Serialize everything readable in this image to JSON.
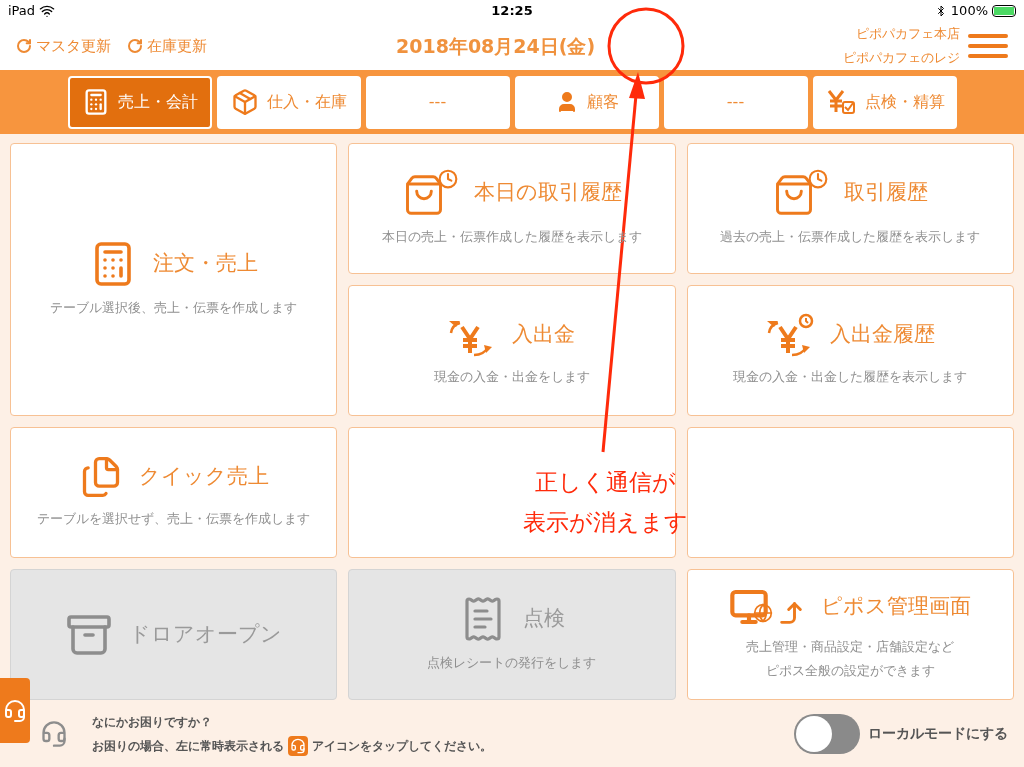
{
  "status_bar": {
    "device": "iPad",
    "time": "12:25",
    "battery": "100%"
  },
  "header": {
    "actions": [
      {
        "label": "マスタ更新"
      },
      {
        "label": "在庫更新"
      }
    ],
    "date": "2018年08月24日(金)",
    "store": "ピポパカフェ本店",
    "register": "ピポパカフェのレジ"
  },
  "tabs": [
    {
      "label": "売上・会計",
      "kind": "calculator",
      "selected": true
    },
    {
      "label": "仕入・在庫",
      "kind": "box",
      "selected": false
    },
    {
      "label": "---",
      "kind": "none",
      "selected": false
    },
    {
      "label": "顧客",
      "kind": "person",
      "selected": false
    },
    {
      "label": "---",
      "kind": "none",
      "selected": false
    },
    {
      "label": "点検・精算",
      "kind": "yen-check",
      "selected": false
    }
  ],
  "tiles": [
    {
      "kind": "calculator",
      "title": "注文・売上",
      "subtitle": [
        "テーブル選択後、売上・伝票を作成します"
      ],
      "disabled": false
    },
    {
      "kind": "bag-clock",
      "title": "本日の取引履歴",
      "subtitle": [
        "本日の売上・伝票作成した履歴を表示します"
      ],
      "disabled": false
    },
    {
      "kind": "bag-clock",
      "title": "取引履歴",
      "subtitle": [
        "過去の売上・伝票作成した履歴を表示します"
      ],
      "disabled": false
    },
    {
      "kind": "yen",
      "title": "入出金",
      "subtitle": [
        "現金の入金・出金をします"
      ],
      "disabled": false
    },
    {
      "kind": "yen-clock",
      "title": "入出金履歴",
      "subtitle": [
        "現金の入金・出金した履歴を表示します"
      ],
      "disabled": false
    },
    {
      "kind": "files",
      "title": "クイック売上",
      "subtitle": [
        "テーブルを選択せず、売上・伝票を作成します"
      ],
      "disabled": false
    },
    {
      "kind": "blank"
    },
    {
      "kind": "blank"
    },
    {
      "kind": "drawer",
      "title": "ドロアオープン",
      "disabled": true
    },
    {
      "kind": "receipt",
      "title": "点検",
      "subtitle": [
        "点検レシートの発行をします"
      ],
      "disabled": true
    },
    {
      "kind": "monitor",
      "title": "ピポス管理画面",
      "subtitle": [
        "売上管理・商品設定・店舗設定など",
        "ピポス全般の設定ができます"
      ],
      "disabled": false
    }
  ],
  "help": {
    "question": "なにかお困りですか？",
    "before_icon": "お困りの場合、左に常時表示される",
    "after_icon": "アイコンをタップしてください。"
  },
  "local_mode": {
    "label": "ローカルモードにする",
    "on": false
  },
  "annotation": {
    "lines": [
      "正しく通信が",
      "表示が消えます"
    ]
  }
}
